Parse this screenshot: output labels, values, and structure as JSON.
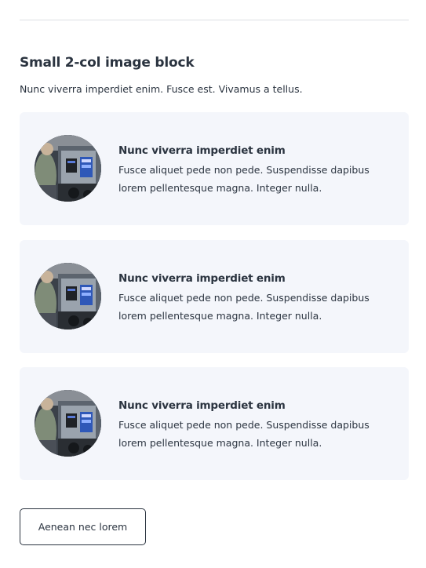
{
  "section": {
    "title": "Small 2-col image block",
    "subtitle": "Nunc viverra imperdiet enim. Fusce est. Vivamus a tellus."
  },
  "cards": [
    {
      "title": "Nunc viverra imperdiet enim",
      "text": "Fusce aliquet pede non pede. Suspendisse dapibus lorem pellentesque magna. Integer nulla."
    },
    {
      "title": "Nunc viverra imperdiet enim",
      "text": "Fusce aliquet pede non pede. Suspendisse dapibus lorem pellentesque magna. Integer nulla."
    },
    {
      "title": "Nunc viverra imperdiet enim",
      "text": "Fusce aliquet pede non pede. Suspendisse dapibus lorem pellentesque magna. Integer nulla."
    }
  ],
  "button": {
    "label": "Aenean nec lorem"
  },
  "colors": {
    "text": "#2b3440",
    "card_background": "#f4f6fb",
    "divider": "#dcdfe4"
  }
}
